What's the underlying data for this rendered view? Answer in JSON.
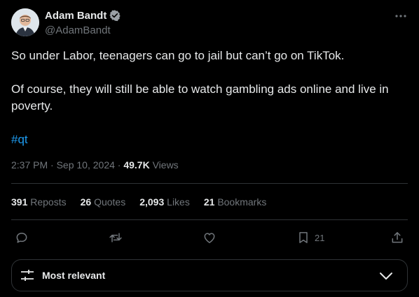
{
  "author": {
    "name": "Adam Bandt",
    "handle": "@AdamBandt",
    "verified": true
  },
  "tweet": {
    "line1": "So under Labor, teenagers can go to jail but can’t go on TikTok.",
    "line2": "Of course, they will still be able to watch gambling ads online and live in poverty.",
    "hashtag": "#qt",
    "time": "2:37 PM",
    "date": "Sep 10, 2024",
    "views_count": "49.7K",
    "views_label": "Views"
  },
  "stats": {
    "reposts": {
      "count": "391",
      "label": "Reposts"
    },
    "quotes": {
      "count": "26",
      "label": "Quotes"
    },
    "likes": {
      "count": "2,093",
      "label": "Likes"
    },
    "bookmarks": {
      "count": "21",
      "label": "Bookmarks"
    }
  },
  "actions": {
    "bookmark_count": "21"
  },
  "sort": {
    "label": "Most relevant"
  },
  "colors": {
    "background": "#000000",
    "text": "#e7e9ea",
    "muted": "#71767b",
    "accent": "#1d9bf0",
    "border": "#2f3336"
  },
  "icons": [
    "verified-badge-icon",
    "more-icon",
    "reply-icon",
    "repost-icon",
    "like-icon",
    "bookmark-icon",
    "share-icon",
    "sort-sliders-icon",
    "chevron-down-icon"
  ]
}
